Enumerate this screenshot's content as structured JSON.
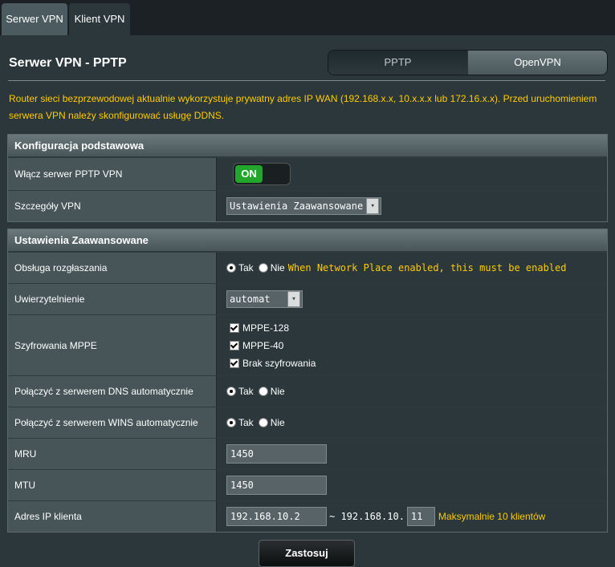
{
  "tabs": [
    "Serwer VPN",
    "Klient VPN"
  ],
  "page_title": "Serwer VPN - PPTP",
  "segment": {
    "pptp": "PPTP",
    "openvpn": "OpenVPN"
  },
  "warning": "Router sieci bezprzewodowej aktualnie wykorzystuje prywatny adres IP WAN (192.168.x.x, 10.x.x.x lub 172.16.x.x). Przed uruchomieniem serwera VPN należy skonfigurować usługę DDNS.",
  "basic": {
    "header": "Konfiguracja podstawowa",
    "enable_label": "Włącz serwer PPTP VPN",
    "toggle_text": "ON",
    "details_label": "Szczegóły VPN",
    "details_value": "Ustawienia Zaawansowane"
  },
  "advanced": {
    "header": "Ustawienia Zaawansowane",
    "broadcast_label": "Obsługa rozgłaszania",
    "broadcast_hint": "When Network Place enabled, this must be enabled",
    "auth_label": "Uwierzytelnienie",
    "auth_value": "automat",
    "mppe_label": "Szyfrowania MPPE",
    "mppe_options": [
      "MPPE-128",
      "MPPE-40",
      "Brak szyfrowania"
    ],
    "dns_label": "Połączyć z serwerem DNS automatycznie",
    "wins_label": "Połączyć z serwerem WINS automatycznie",
    "mru_label": "MRU",
    "mru_value": "1450",
    "mtu_label": "MTU",
    "mtu_value": "1450",
    "ip_label": "Adres IP klienta",
    "ip_start": "192.168.10.2",
    "ip_sep": "~ 192.168.10.",
    "ip_end": "11",
    "ip_hint": "Maksymalnie 10 klientów"
  },
  "radio": {
    "yes": "Tak",
    "no": "Nie"
  },
  "apply_label": "Zastosuj",
  "colors": {
    "accent_yellow": "#ffcc00",
    "toggle_green": "#22a62c",
    "background": "#2b373b"
  }
}
